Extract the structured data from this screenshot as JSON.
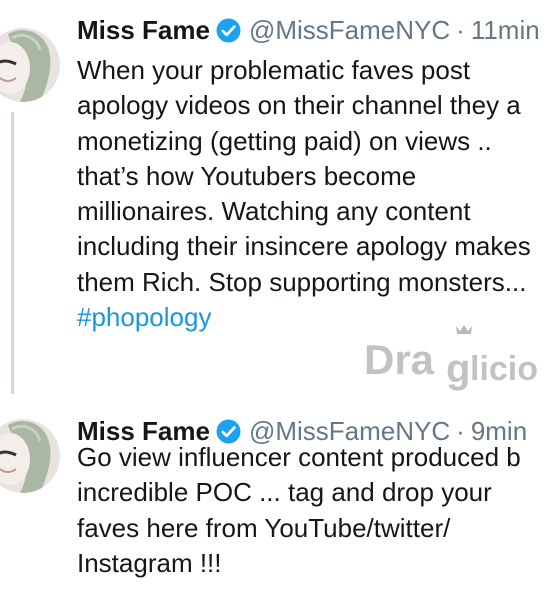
{
  "tweets": [
    {
      "name": "Miss Fame",
      "handle": "@MissFameNYC",
      "separator": "·",
      "time": "11min",
      "lines": [
        "When your problematic faves post",
        "apology videos on their channel they  a",
        "monetizing (getting paid) on views ..",
        "that’s how Youtubers become",
        "millionaires. Watching any content",
        "including their insincere apology makes",
        "them Rich. Stop supporting monsters..."
      ],
      "hashtag": "#phopology"
    },
    {
      "name": "Miss Fame",
      "handle": "@MissFameNYC",
      "separator": "·",
      "time": "9min",
      "lines": [
        "Go view influencer content produced b",
        "incredible POC ... tag and drop your",
        "faves here from YouTube/twitter/",
        "Instagram !!!"
      ]
    }
  ],
  "watermark": {
    "text": "Draglicious"
  },
  "colors": {
    "text": "#14171a",
    "secondary": "#657786",
    "link": "#1b95e0",
    "verified": "#1da1f2",
    "thread_line": "#cfd9de"
  },
  "icons": {
    "verified": "verified-badge-icon",
    "avatar": "profile-photo"
  }
}
